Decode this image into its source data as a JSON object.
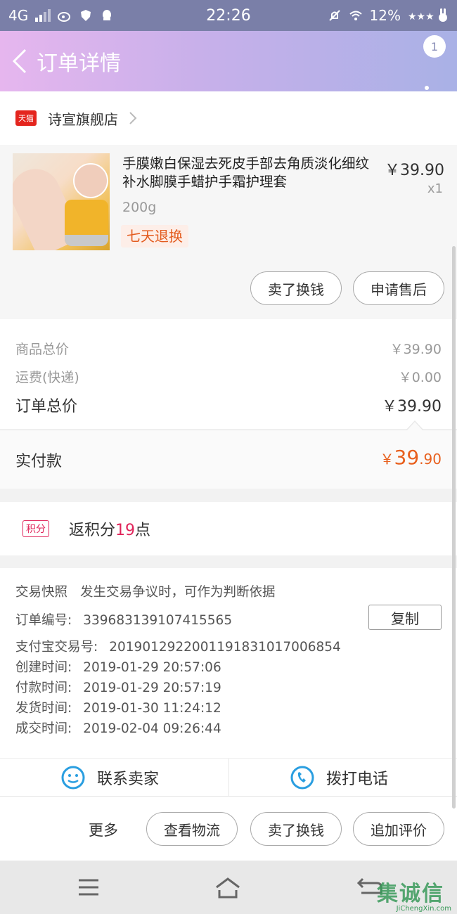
{
  "status_bar": {
    "network": "4G",
    "time": "22:26",
    "battery": "12%"
  },
  "nav": {
    "title": "订单详情",
    "badge_count": "1"
  },
  "shop": {
    "logo_text": "天猫",
    "name": "诗宣旗舰店"
  },
  "product": {
    "title": "手膜嫩白保湿去死皮手部去角质淡化细纹补水脚膜手蜡护手霜护理套",
    "price": "￥39.90",
    "quantity": "x1",
    "sku": "200g",
    "tag": "七天退换",
    "actions": [
      "卖了换钱",
      "申请售后"
    ]
  },
  "summary": {
    "goods_total_label": "商品总价",
    "goods_total_value": "￥39.90",
    "shipping_label": "运费(快递)",
    "shipping_value": "￥0.00",
    "order_total_label": "订单总价",
    "order_total_value": "￥39.90",
    "paid_label": "实付款",
    "paid_currency": "￥",
    "paid_int": "39",
    "paid_dec": ".90"
  },
  "points": {
    "badge": "积分",
    "text_prefix": "返积分",
    "value": "19",
    "text_suffix": "点"
  },
  "order_info": {
    "snapshot_label": "交易快照",
    "snapshot_desc": "发生交易争议时，可作为判断依据",
    "order_no_label": "订单编号:",
    "order_no": "339683139107415565",
    "copy_label": "复制",
    "alipay_label": "支付宝交易号:",
    "alipay_no": "2019012922001191831017006854",
    "created_label": "创建时间:",
    "created": "2019-01-29 20:57:06",
    "paid_label": "付款时间:",
    "paid": "2019-01-29 20:57:19",
    "shipped_label": "发货时间:",
    "shipped": "2019-01-30 11:24:12",
    "done_label": "成交时间:",
    "done": "2019-02-04 09:26:44"
  },
  "contact": {
    "seller": "联系卖家",
    "phone": "拨打电话"
  },
  "bottom": {
    "more": "更多",
    "logistics": "查看物流",
    "sell": "卖了换钱",
    "review": "追加评价"
  },
  "watermark": {
    "main": "集诚信",
    "sub": "JiChengXin.com"
  },
  "colors": {
    "accent": "#e8601e",
    "points": "#e0245a",
    "tmall": "#e4251e"
  }
}
